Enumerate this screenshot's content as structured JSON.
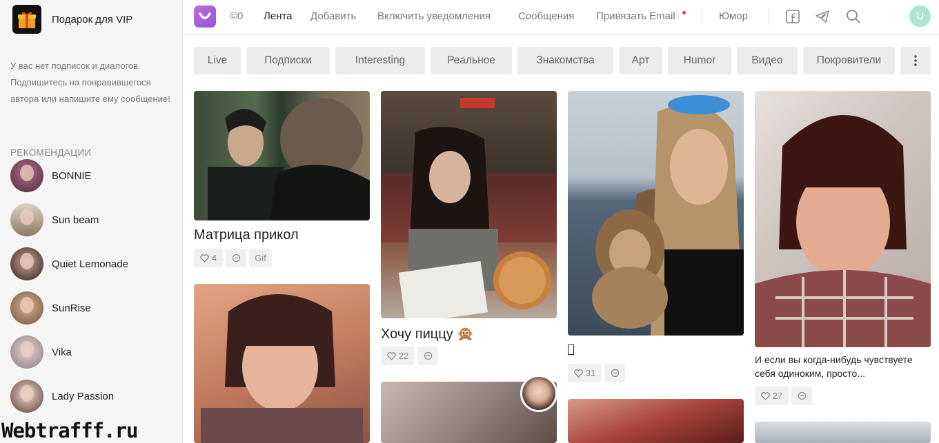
{
  "sidebar": {
    "vip_label": "Подарок для VIP",
    "info_text": "У вас нет подписок и диалогов. Подпишитесь на понравившегося автора или напишите ему сообщение!",
    "recommendations_heading": "РЕКОМЕНДАЦИИ",
    "recommendations": [
      {
        "name": "BONNIE"
      },
      {
        "name": "Sun beam"
      },
      {
        "name": "Quiet Lemonade"
      },
      {
        "name": "SunRise"
      },
      {
        "name": "Vika"
      },
      {
        "name": "Lady Passion"
      }
    ]
  },
  "watermark": "Webtrafff.ru",
  "topbar": {
    "coins": "©0",
    "feed": "Лента",
    "add": "Добавить",
    "notifications": "Включить уведомления",
    "messages": "Сообщения",
    "bind_email": "Привязать Email",
    "humor": "Юмор",
    "user_initial": "U"
  },
  "tabs": [
    "Live",
    "Подписки",
    "Interesting",
    "Реальное",
    "Знакомства",
    "Арт",
    "Humor",
    "Видео",
    "Покровители"
  ],
  "cards": {
    "c1": {
      "title": "Матрица прикол",
      "likes": "4",
      "tag": "Gif"
    },
    "c2": {
      "title": "Хочу пиццу 🙊",
      "likes": "22"
    },
    "c3": {
      "title": "",
      "likes": "31"
    },
    "c4": {
      "title": "И если вы когда-нибудь чувствуете себя одиноким, просто...",
      "likes": "27"
    }
  },
  "colors": {
    "accent": "#b064d6",
    "notification_dot": "#e0443a",
    "tab_bg": "#ececec",
    "sidebar_bg": "#f5f5f5"
  }
}
